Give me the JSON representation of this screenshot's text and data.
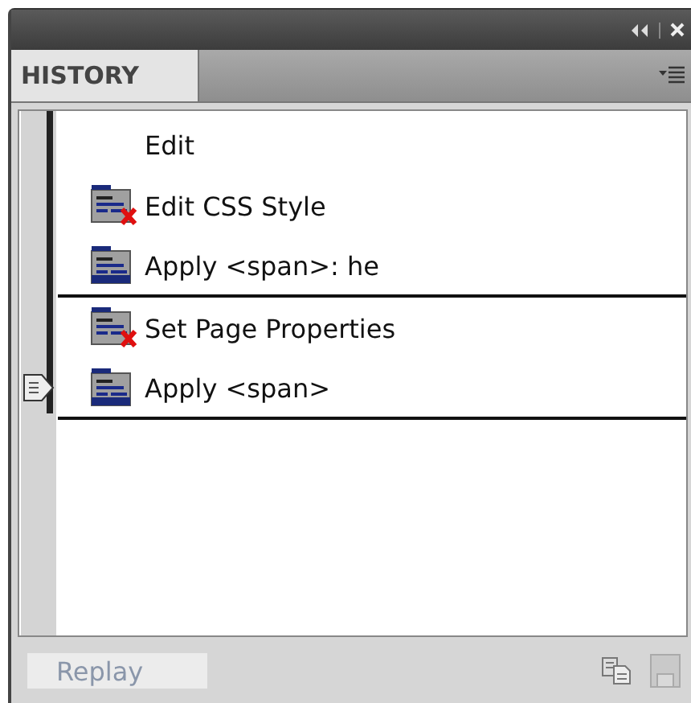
{
  "panel": {
    "tab": {
      "label": "HISTORY",
      "selected": true
    }
  },
  "steps": [
    {
      "label": "Edit",
      "kind": "none",
      "separator_after": false,
      "selected": false
    },
    {
      "label": "Edit CSS Style",
      "kind": "undone",
      "separator_after": false,
      "selected": false
    },
    {
      "label": "Apply <span>: he",
      "kind": "step",
      "separator_after": true,
      "selected": false
    },
    {
      "label": "Set Page Properties",
      "kind": "undone",
      "separator_after": false,
      "selected": false
    },
    {
      "label": "Apply <span>",
      "kind": "step",
      "separator_after": true,
      "selected": true
    }
  ],
  "footer": {
    "replay": {
      "label": "Replay",
      "disabled": true
    },
    "copy": {
      "disabled": false
    },
    "save": {
      "disabled": true
    }
  }
}
